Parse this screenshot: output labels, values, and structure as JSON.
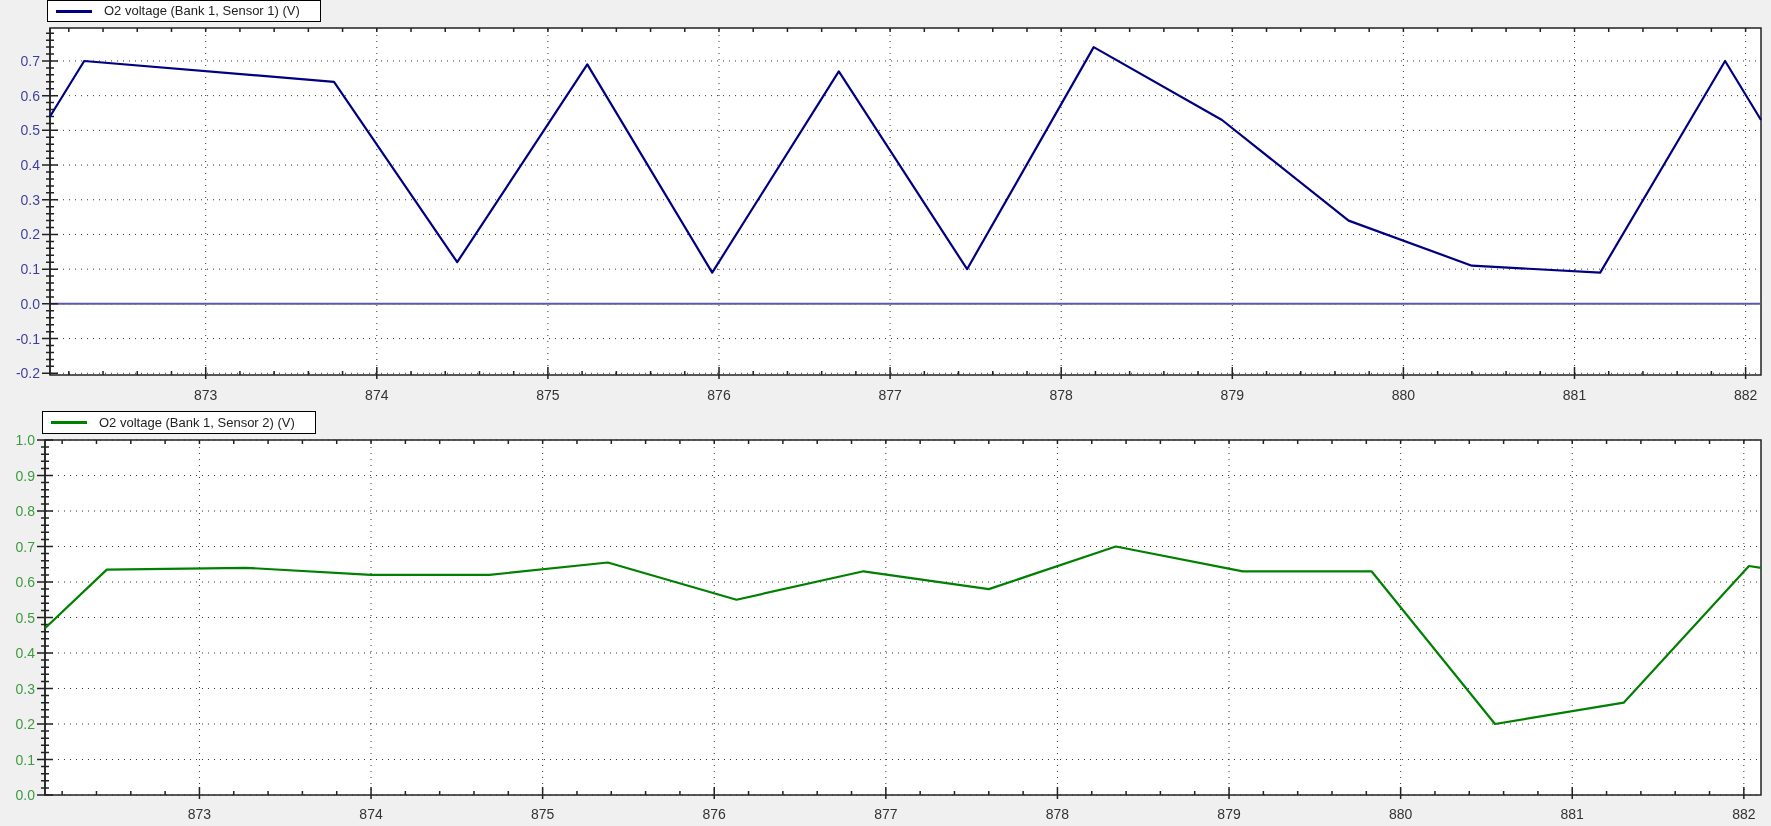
{
  "charts": [
    {
      "chart_data": {
        "type": "line",
        "grid": true,
        "x": [
          872.09,
          872.29,
          873.75,
          874.47,
          875.23,
          875.96,
          876.7,
          877.45,
          878.19,
          878.94,
          879.68,
          880.4,
          881.15,
          881.88,
          882.09
        ],
        "series": [
          {
            "name": "O2 voltage (Bank 1, Sensor 1) (V)",
            "color": "#000080",
            "values": [
              0.54,
              0.7,
              0.64,
              0.12,
              0.69,
              0.09,
              0.67,
              0.1,
              0.74,
              0.53,
              0.24,
              0.11,
              0.09,
              0.7,
              0.53
            ]
          }
        ],
        "xlim": [
          872.09,
          882.09
        ],
        "ylim": [
          -0.205,
          0.795
        ],
        "xticks": [
          873,
          874,
          875,
          876,
          877,
          878,
          879,
          880,
          881,
          882
        ],
        "yticks": [
          {
            "value": -0.2,
            "label": "-0.2"
          },
          {
            "value": -0.1,
            "label": "-0.1"
          },
          {
            "value": 0,
            "label": "0.0"
          },
          {
            "value": 0.1,
            "label": "0.1"
          },
          {
            "value": 0.2,
            "label": "0.2"
          },
          {
            "value": 0.3,
            "label": "0.3"
          },
          {
            "value": 0.4,
            "label": "0.4"
          },
          {
            "value": 0.5,
            "label": "0.5"
          },
          {
            "value": 0.6,
            "label": "0.6"
          },
          {
            "value": 0.7,
            "label": "0.7"
          }
        ],
        "ref_lines": [
          {
            "axis": "y",
            "value": 0
          }
        ]
      }
    },
    {
      "chart_data": {
        "type": "line",
        "grid": true,
        "x": [
          872.1,
          872.46,
          873.27,
          874.0,
          874.69,
          875.38,
          876.13,
          876.87,
          877.6,
          878.34,
          879.08,
          879.83,
          880.55,
          881.3,
          882.03,
          882.1
        ],
        "series": [
          {
            "name": "O2 voltage (Bank 1, Sensor 2) (V)",
            "color": "#008000",
            "values": [
              0.47,
              0.635,
              0.64,
              0.62,
              0.62,
              0.655,
              0.55,
              0.63,
              0.58,
              0.7,
              0.63,
              0.63,
              0.2,
              0.26,
              0.645,
              0.64
            ]
          }
        ],
        "xlim": [
          872.1,
          882.1
        ],
        "ylim": [
          0,
          1
        ],
        "xticks": [
          873,
          874,
          875,
          876,
          877,
          878,
          879,
          880,
          881,
          882
        ],
        "yticks": [
          {
            "value": 0,
            "label": "0.0"
          },
          {
            "value": 0.1,
            "label": "0.1"
          },
          {
            "value": 0.2,
            "label": "0.2"
          },
          {
            "value": 0.3,
            "label": "0.3"
          },
          {
            "value": 0.4,
            "label": "0.4"
          },
          {
            "value": 0.5,
            "label": "0.5"
          },
          {
            "value": 0.6,
            "label": "0.6"
          },
          {
            "value": 0.7,
            "label": "0.7"
          },
          {
            "value": 0.8,
            "label": "0.8"
          },
          {
            "value": 0.9,
            "label": "0.9"
          },
          {
            "value": 1.0,
            "label": "1.0"
          }
        ]
      }
    }
  ]
}
